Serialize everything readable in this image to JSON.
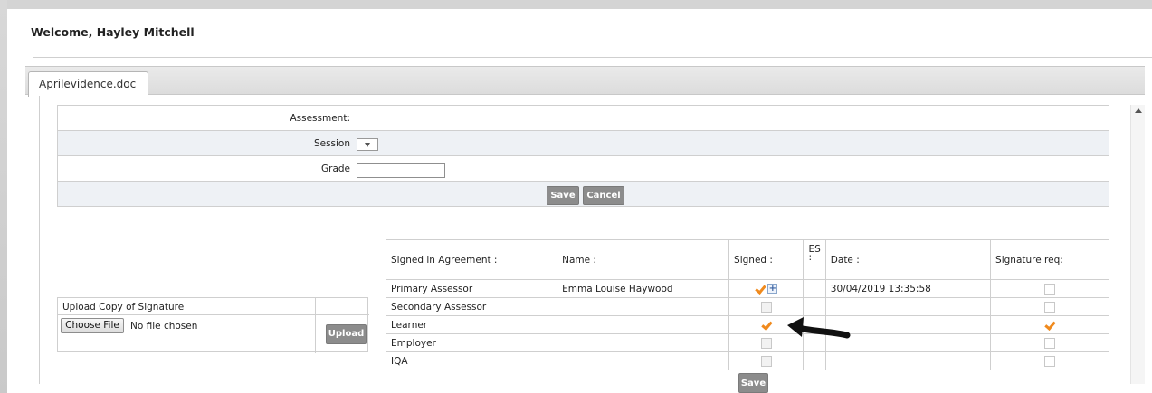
{
  "welcome": "Welcome, Hayley Mitchell",
  "tab": {
    "label": "Aprilevidence.doc"
  },
  "form": {
    "assessment_label": "Assessment:",
    "session_label": "Session",
    "grade_label": "Grade",
    "grade_value": "",
    "save_label": "Save",
    "cancel_label": "Cancel"
  },
  "upload": {
    "heading": "Upload Copy of Signature",
    "choose_label": "Choose File",
    "no_file": "No file chosen",
    "upload_label": "Upload"
  },
  "signatures": {
    "headers": [
      "Signed in Agreement :",
      "Name :",
      "Signed :",
      "ES :",
      "Date :",
      "Signature req:"
    ],
    "rows": [
      {
        "role": "Primary Assessor",
        "name": "Emma Louise Haywood",
        "signed": true,
        "date": "30/04/2019 13:35:58",
        "sig_req": false
      },
      {
        "role": "Secondary Assessor",
        "name": "",
        "signed": false,
        "date": "",
        "sig_req": false
      },
      {
        "role": "Learner",
        "name": "",
        "signed": true,
        "date": "",
        "sig_req": true
      },
      {
        "role": "Employer",
        "name": "",
        "signed": false,
        "date": "",
        "sig_req": false
      },
      {
        "role": "IQA",
        "name": "",
        "signed": false,
        "date": "",
        "sig_req": false
      }
    ],
    "save_label": "Save"
  },
  "colors": {
    "tick": "#f08a1d",
    "button": "#8c8c8c",
    "alt_row": "#eef1f5"
  }
}
